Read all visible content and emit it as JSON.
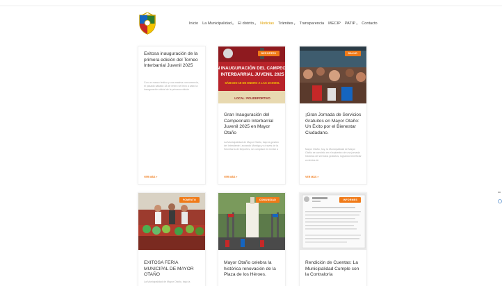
{
  "nav": {
    "items": [
      {
        "label": "Inicio",
        "caret": false,
        "active": false
      },
      {
        "label": "La Municipalidad",
        "caret": true,
        "active": false
      },
      {
        "label": "El distrito",
        "caret": true,
        "active": false
      },
      {
        "label": "Noticias",
        "caret": false,
        "active": true
      },
      {
        "label": "Trámites",
        "caret": true,
        "active": false
      },
      {
        "label": "Transparencia",
        "caret": false,
        "active": false
      },
      {
        "label": "MECIP",
        "caret": false,
        "active": false
      },
      {
        "label": "PATIP",
        "caret": true,
        "active": false
      },
      {
        "label": "Contacto",
        "caret": false,
        "active": false
      }
    ],
    "caret_glyph": "▾"
  },
  "cards": [
    {
      "title": "Exitosa inauguración de la primera edición del Torneo Interbarrial Juvenil 2025",
      "excerpt": "Con un marco festivo y una masiva concurrencia, el pasado sábado 18 de enero se llevó a cabo la inauguración oficial de la primera edición",
      "more": "VER MÁS »",
      "badge": ""
    },
    {
      "title": "Gran Inauguración del Campeonato Interbarrial Juvenil 2025 en Mayor Otaño",
      "excerpt": "La Municipalidad de Mayor Otaño, bajo la gestión del Intendente Leonardo Montigo y a través de la Secretaría de Deportes, se complace en invitar a",
      "more": "VER MÁS »",
      "badge": "DEPORTES",
      "image_text": [
        "GRAN INAUGURACIÓN DEL CAMPEONATO",
        "INTERBARRIAL JUVENIL 2025",
        "SÁBADO 18 DE ENERO A LAS 19:00HS.",
        "LOCAL: POLIDEPORTIVO"
      ]
    },
    {
      "title": "¡Gran Jornada de Servicios Gratuitos en Mayor Otaño: Un Éxito por el Bienestar Ciudadano.",
      "excerpt": "Mayor Otaño, hoy, la Municipalidad de Mayor Otaño se convirtió en el epicentro de una jornada histórica de servicios gratuitos, logrando beneficiar a cientos de",
      "more": "VER MÁS »",
      "badge": "SALUD"
    },
    {
      "title": "EXITOSA FERIA MUNICIPAL DE MAYOR OTAÑO",
      "excerpt": "La Municipalidad de Mayor Otaño, bajo la",
      "more": "",
      "badge": "FOMENTO"
    },
    {
      "title": "Mayor Otaño celebra la histórica renovación de la Plaza de los Héroes.",
      "excerpt": "",
      "more": "",
      "badge": "COMUNIDAD"
    },
    {
      "title": "Rendición de Cuentas: La Municipalidad Cumple con la Contraloría",
      "excerpt": "",
      "more": "",
      "badge": "INFORMES"
    }
  ],
  "colors": {
    "accent": "#f07a18",
    "nav_active": "#e0a100",
    "title": "#333333",
    "excerpt": "#a8a8a8"
  }
}
